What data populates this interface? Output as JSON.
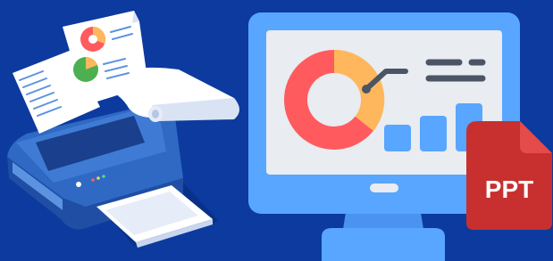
{
  "illustration": {
    "badge": {
      "label": "PPT"
    },
    "colors": {
      "background": "#0c3a9e",
      "monitor_frame": "#58a6ff",
      "screen": "#e9ecf1",
      "donut_main": "#ff5b5f",
      "donut_accent": "#ffb75d",
      "bars": "#58a6ff",
      "ppt_badge": "#c7302e",
      "ppt_fold": "#e44b49",
      "printer_body": "#2f69c4",
      "paper": "#ffffff"
    },
    "icons": [
      "printer-icon",
      "paper-stack-icon",
      "monitor-icon",
      "donut-chart-icon",
      "bar-chart-icon",
      "ppt-file-icon"
    ]
  }
}
